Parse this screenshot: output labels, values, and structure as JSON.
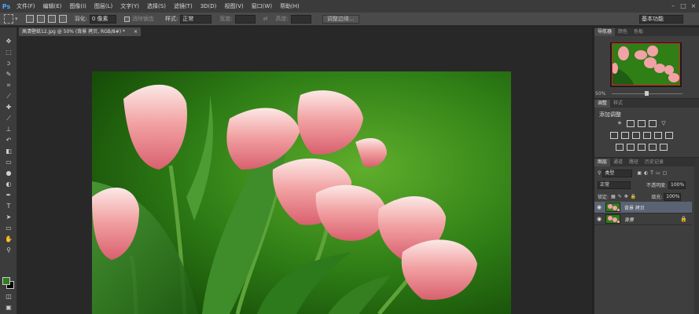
{
  "app": {
    "logo": "Ps"
  },
  "menu": [
    "文件(F)",
    "编辑(E)",
    "图像(I)",
    "图层(L)",
    "文字(Y)",
    "选择(S)",
    "滤镜(T)",
    "3D(D)",
    "视图(V)",
    "窗口(W)",
    "帮助(H)"
  ],
  "window_controls": [
    "–",
    "□",
    "×"
  ],
  "options": {
    "feather_label": "羽化:",
    "feather_value": "0 像素",
    "antialias_label": "消除锯齿",
    "style_label": "样式:",
    "style_value": "正常",
    "width_label": "宽度:",
    "height_label": "高度:",
    "refine_edge": "调整边缘...",
    "workspace": "基本功能"
  },
  "document": {
    "tab_title": "高清壁纸12.jpg @ 50% (背景 拷贝, RGB/8#) *",
    "close": "×"
  },
  "colors": {
    "foreground": "#2e7d1f",
    "background": "#000000",
    "accent": "#4da3ff"
  },
  "panels": {
    "nav_tabs": [
      "导航器",
      "颜色",
      "色板"
    ],
    "zoom": "50%",
    "adj_tabs": [
      "调整",
      "样式"
    ],
    "adj_title": "添加调整",
    "layers_tabs": [
      "图层",
      "通道",
      "路径",
      "历史记录"
    ],
    "kind_label": "类型",
    "blend_mode": "正常",
    "opacity_label": "不透明度:",
    "opacity_value": "100%",
    "lock_label": "锁定:",
    "fill_label": "填充:",
    "fill_value": "100%",
    "layers": [
      {
        "name": "背景 拷贝",
        "selected": true
      },
      {
        "name": "背景",
        "selected": false
      }
    ]
  }
}
